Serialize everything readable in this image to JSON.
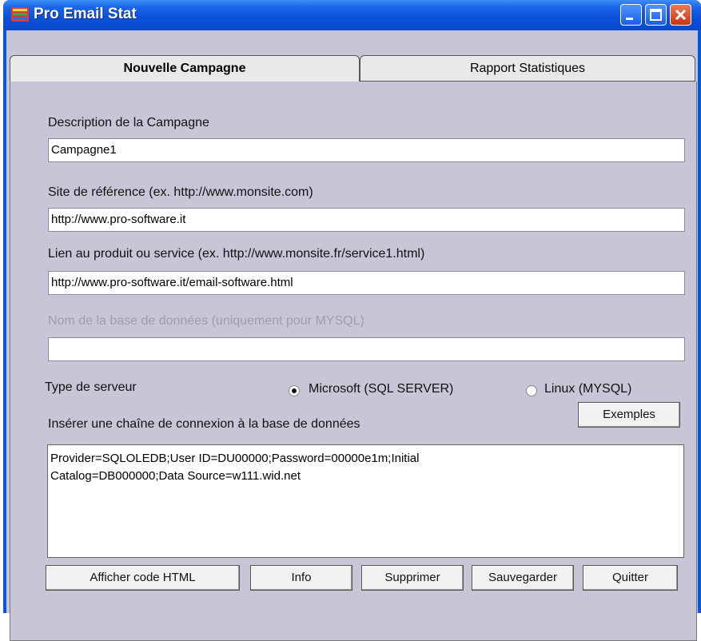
{
  "window": {
    "title": "Pro Email Stat"
  },
  "tabs": [
    {
      "label": "Nouvelle Campagne",
      "active": true
    },
    {
      "label": "Rapport Statistiques",
      "active": false
    }
  ],
  "form": {
    "description_label": "Description de la Campagne",
    "description_value": "Campagne1",
    "site_label": "Site de référence (ex. http://www.monsite.com)",
    "site_value": "http://www.pro-software.it",
    "link_label": "Lien au produit ou service (ex. http://www.monsite.fr/service1.html)",
    "link_value": "http://www.pro-software.it/email-software.html",
    "dbname_label": "Nom de la base de données (uniquement pour MYSQL)",
    "dbname_value": "",
    "server_type_label": "Type de serveur",
    "server_options": [
      {
        "label": "Microsoft (SQL SERVER)",
        "selected": true
      },
      {
        "label": "Linux (MYSQL)",
        "selected": false
      }
    ],
    "examples_button": "Exemples",
    "connection_label": "Insérer une chaîne de connexion à la base de données",
    "connection_value": "Provider=SQLOLEDB;User ID=DU00000;Password=00000e1m;Initial\nCatalog=DB000000;Data Source=w111.wid.net"
  },
  "buttons": {
    "show_html": "Afficher code HTML",
    "info": "Info",
    "delete": "Supprimer",
    "save": "Sauvegarder",
    "quit": "Quitter"
  },
  "colors": {
    "titlebar": "#0a55e0",
    "client_bg": "#c7c6d7",
    "close_button": "#d9441a"
  }
}
